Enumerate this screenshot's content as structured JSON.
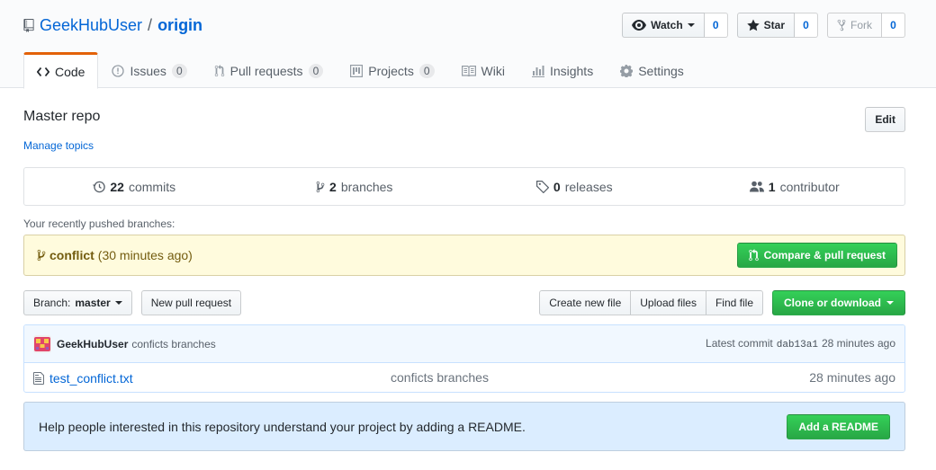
{
  "repo": {
    "owner": "GeekHubUser",
    "separator": "/",
    "name": "origin"
  },
  "actions": {
    "watch": {
      "label": "Watch",
      "count": "0"
    },
    "star": {
      "label": "Star",
      "count": "0"
    },
    "fork": {
      "label": "Fork",
      "count": "0"
    }
  },
  "tabs": [
    {
      "label": "Code",
      "icon": "code-icon",
      "selected": true
    },
    {
      "label": "Issues",
      "count": "0",
      "icon": "issue-icon"
    },
    {
      "label": "Pull requests",
      "count": "0",
      "icon": "pull-request-icon"
    },
    {
      "label": "Projects",
      "count": "0",
      "icon": "project-icon"
    },
    {
      "label": "Wiki",
      "icon": "book-icon"
    },
    {
      "label": "Insights",
      "icon": "graph-icon"
    },
    {
      "label": "Settings",
      "icon": "gear-icon"
    }
  ],
  "description": "Master repo",
  "manage_topics": "Manage topics",
  "edit_label": "Edit",
  "summary": {
    "commits": {
      "num": "22",
      "label": "commits"
    },
    "branches": {
      "num": "2",
      "label": "branches"
    },
    "releases": {
      "num": "0",
      "label": "releases"
    },
    "contributors": {
      "num": "1",
      "label": "contributor"
    }
  },
  "recent": {
    "label": "Your recently pushed branches:",
    "branch": "conflict",
    "age": "(30 minutes ago)",
    "compare_label": "Compare & pull request"
  },
  "filenav": {
    "branch_prefix": "Branch:",
    "branch": "master",
    "new_pr": "New pull request",
    "create_file": "Create new file",
    "upload_files": "Upload files",
    "find_file": "Find file",
    "clone": "Clone or download"
  },
  "commit": {
    "author": "GeekHubUser",
    "message": "conficts branches",
    "latest_label": "Latest commit",
    "sha": "dab13a1",
    "age": "28 minutes ago"
  },
  "files": [
    {
      "name": "test_conflict.txt",
      "message": "conficts branches",
      "age": "28 minutes ago"
    }
  ],
  "readme": {
    "text": "Help people interested in this repository understand your project by adding a README.",
    "button": "Add a README"
  },
  "colors": {
    "link": "#0366d6",
    "tab_accent": "#e36209",
    "green": "#28a745",
    "recent_bg": "#fffbdd",
    "readme_bg": "#dbedff"
  }
}
